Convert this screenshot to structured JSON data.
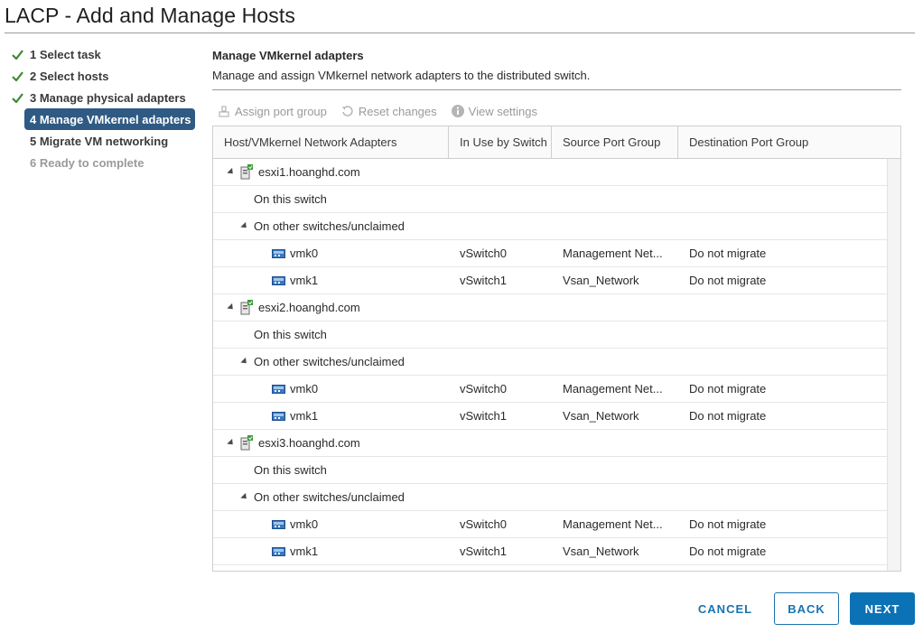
{
  "window": {
    "title": "LACP - Add and Manage Hosts"
  },
  "steps": [
    {
      "label": "1 Select task",
      "state": "done"
    },
    {
      "label": "2 Select hosts",
      "state": "done"
    },
    {
      "label": "3 Manage physical adapters",
      "state": "done"
    },
    {
      "label": "4 Manage VMkernel adapters",
      "state": "active"
    },
    {
      "label": "5 Migrate VM networking",
      "state": "pending"
    },
    {
      "label": "6 Ready to complete",
      "state": "disabled"
    }
  ],
  "main": {
    "heading": "Manage VMkernel adapters",
    "description": "Manage and assign VMkernel network adapters to the distributed switch."
  },
  "toolbar": {
    "assign_label": "Assign port group",
    "reset_label": "Reset changes",
    "view_label": "View settings"
  },
  "grid": {
    "columns": [
      "Host/VMkernel Network Adapters",
      "In Use by Switch",
      "Source Port Group",
      "Destination Port Group"
    ],
    "hosts": [
      {
        "name": "esxi1.hoanghd.com",
        "on_switch": "On this switch",
        "other": "On other switches/unclaimed",
        "adapters": [
          {
            "name": "vmk0",
            "switch": "vSwitch0",
            "source": "Management Net...",
            "dest": "Do not migrate"
          },
          {
            "name": "vmk1",
            "switch": "vSwitch1",
            "source": "Vsan_Network",
            "dest": "Do not migrate"
          }
        ]
      },
      {
        "name": "esxi2.hoanghd.com",
        "on_switch": "On this switch",
        "other": "On other switches/unclaimed",
        "adapters": [
          {
            "name": "vmk0",
            "switch": "vSwitch0",
            "source": "Management Net...",
            "dest": "Do not migrate"
          },
          {
            "name": "vmk1",
            "switch": "vSwitch1",
            "source": "Vsan_Network",
            "dest": "Do not migrate"
          }
        ]
      },
      {
        "name": "esxi3.hoanghd.com",
        "on_switch": "On this switch",
        "other": "On other switches/unclaimed",
        "adapters": [
          {
            "name": "vmk0",
            "switch": "vSwitch0",
            "source": "Management Net...",
            "dest": "Do not migrate"
          },
          {
            "name": "vmk1",
            "switch": "vSwitch1",
            "source": "Vsan_Network",
            "dest": "Do not migrate"
          }
        ]
      }
    ]
  },
  "buttons": {
    "cancel": "CANCEL",
    "back": "BACK",
    "next": "NEXT"
  },
  "colors": {
    "accent": "#0b72b5",
    "active_step": "#2f5a83",
    "check": "#3c8a2e"
  },
  "icons": {
    "check": "check-icon",
    "host": "host-icon",
    "adapter": "vmkernel-adapter-icon",
    "assign": "assign-port-group-icon",
    "reset": "reset-icon",
    "info": "info-icon"
  }
}
